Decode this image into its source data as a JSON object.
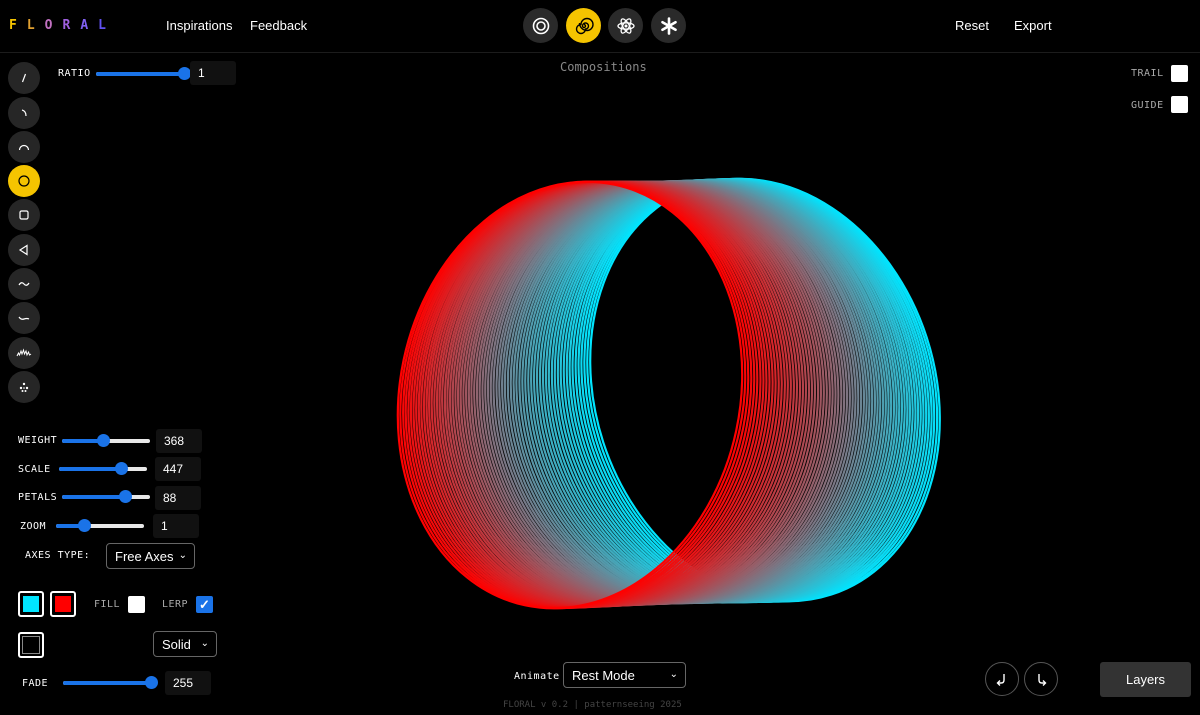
{
  "app": {
    "logo_letters": [
      "F",
      "L",
      "O",
      "R",
      "A",
      "L"
    ],
    "logo_colors": [
      "#f5c400",
      "#e0a030",
      "#c070c0",
      "#a060e0",
      "#8060f0",
      "#6050f0"
    ],
    "version_text": "FLORAL v 0.2 | patternseeing 2025"
  },
  "nav": {
    "inspirations": "Inspirations",
    "feedback": "Feedback",
    "reset": "Reset",
    "export": "Export"
  },
  "modes": [
    {
      "icon": "concentric-circles-icon",
      "active": false
    },
    {
      "icon": "spiral-icon",
      "active": true
    },
    {
      "icon": "atom-icon",
      "active": false
    },
    {
      "icon": "asterisk-icon",
      "active": false
    }
  ],
  "tools": [
    {
      "icon": "line-icon",
      "active": false
    },
    {
      "icon": "short-arc-icon",
      "active": false
    },
    {
      "icon": "arc-icon",
      "active": false
    },
    {
      "icon": "circle-icon",
      "active": true
    },
    {
      "icon": "square-icon",
      "active": false
    },
    {
      "icon": "triangle-icon",
      "active": false
    },
    {
      "icon": "sine-wave-icon",
      "active": false
    },
    {
      "icon": "curve-icon",
      "active": false
    },
    {
      "icon": "zigzag-icon",
      "active": false
    },
    {
      "icon": "sparkle-icon",
      "active": false
    }
  ],
  "ratio": {
    "label": "RATIO",
    "value": "1",
    "fraction": 1.0
  },
  "controls": {
    "weight": {
      "label": "WEIGHT",
      "value": "368",
      "fraction": 0.47
    },
    "scale": {
      "label": "SCALE",
      "value": "447",
      "fraction": 0.71
    },
    "petals": {
      "label": "PETALS",
      "value": "88",
      "fraction": 0.72
    },
    "zoom": {
      "label": "ZOOM",
      "value": "1",
      "fraction": 0.32
    }
  },
  "axes": {
    "label": "AXES TYPE:",
    "selected": "Free Axes"
  },
  "colors": {
    "primary": "#00e5ff",
    "secondary": "#ff0000",
    "stroke": "#000000"
  },
  "fill": {
    "label": "FILL",
    "checked": false
  },
  "lerp": {
    "label": "LERP",
    "checked": true
  },
  "line_style": {
    "selected": "Solid"
  },
  "fade": {
    "label": "FADE",
    "value": "255",
    "fraction": 1.0
  },
  "canvas": {
    "title": "Compositions"
  },
  "toggles": {
    "trail": {
      "label": "TRAIL",
      "checked": false
    },
    "guide": {
      "label": "GUIDE",
      "checked": false
    }
  },
  "animate": {
    "label": "Animate",
    "selected": "Rest Mode"
  },
  "layers": {
    "label": "Layers"
  },
  "history": {
    "undo_icon": "undo-arrow-icon",
    "redo_icon": "redo-arrow-icon"
  }
}
